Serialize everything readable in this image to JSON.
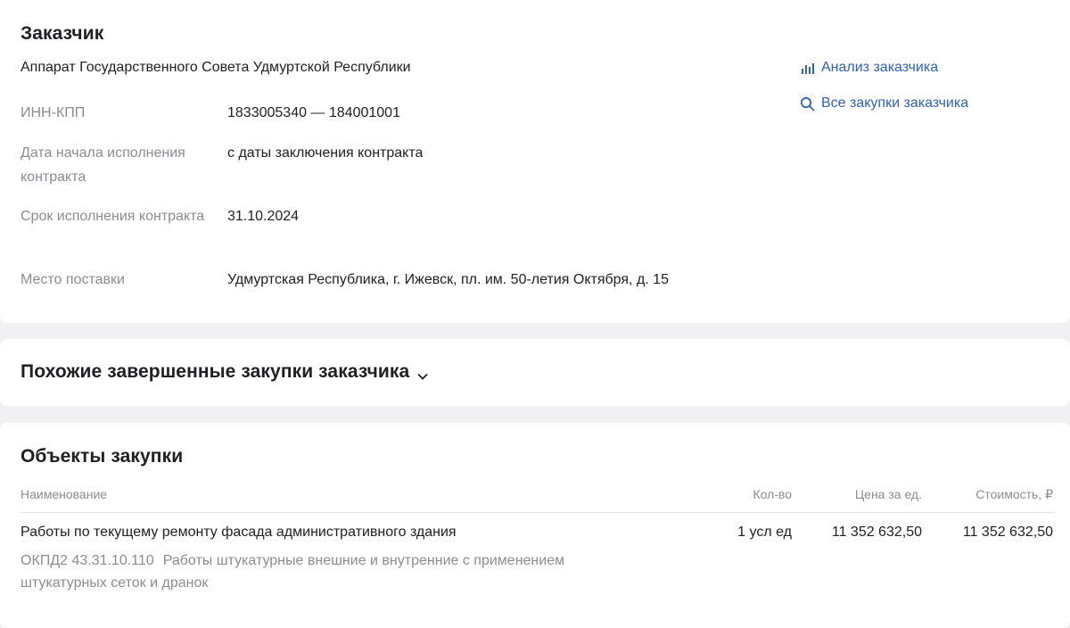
{
  "customer": {
    "title": "Заказчик",
    "org_name": "Аппарат Государственного Совета Удмуртской Республики",
    "links": {
      "analysis": {
        "label": "Анализ заказчика",
        "icon": "bar-chart-icon"
      },
      "all_purchases": {
        "label": "Все закупки заказчика",
        "icon": "search-icon"
      }
    },
    "fields": [
      {
        "label": "ИНН-КПП",
        "value": "1833005340 — 184001001"
      },
      {
        "label": "Дата начала исполнения контракта",
        "value": "с даты заключения контракта"
      },
      {
        "label": "Срок исполнения контракта",
        "value": "31.10.2024"
      },
      {
        "label": "Место поставки",
        "value": "Удмуртская Республика, г. Ижевск, пл. им. 50-летия Октября, д. 15"
      }
    ]
  },
  "similar": {
    "title": "Похожие завершенные закупки заказчика",
    "icon": "chevron-down-icon"
  },
  "objects": {
    "title": "Объекты закупки",
    "columns": {
      "name": "Наименование",
      "qty": "Кол-во",
      "unit_price": "Цена за ед.",
      "cost": "Стоимость, ₽"
    },
    "rows": [
      {
        "name": "Работы по текущему ремонту фасада административного здания",
        "qty": "1 усл ед",
        "unit_price": "11 352 632,50",
        "cost": "11 352 632,50",
        "okpd_code": "ОКПД2 43.31.10.110",
        "okpd_desc": "Работы штукатурные внешние и внутренние с применением штукатурных сеток и дранок"
      }
    ]
  },
  "colors": {
    "accent_link": "#2f62b8",
    "muted_text": "#8c8d94",
    "page_bg": "#f1f1f3"
  }
}
